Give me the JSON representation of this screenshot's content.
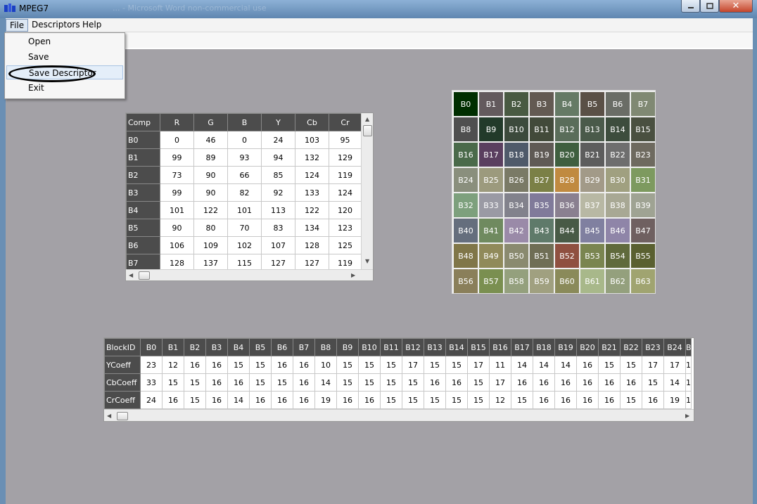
{
  "window": {
    "title": "MPEG7",
    "ghost_title": "... - Microsoft Word non-commercial use"
  },
  "menu": {
    "items": [
      "File",
      "Descriptors",
      "Help"
    ]
  },
  "file_menu": {
    "items": [
      "Open",
      "Save",
      "Save Descriptor",
      "Exit"
    ],
    "highlighted": "Save Descriptor"
  },
  "comp_table": {
    "headers": [
      "Comp",
      "R",
      "G",
      "B",
      "Y",
      "Cb",
      "Cr"
    ],
    "rows": [
      [
        "B0",
        "0",
        "46",
        "0",
        "24",
        "103",
        "95"
      ],
      [
        "B1",
        "99",
        "89",
        "93",
        "94",
        "132",
        "129"
      ],
      [
        "B2",
        "73",
        "90",
        "66",
        "85",
        "124",
        "119"
      ],
      [
        "B3",
        "99",
        "90",
        "82",
        "92",
        "133",
        "124"
      ],
      [
        "B4",
        "101",
        "122",
        "101",
        "113",
        "122",
        "120"
      ],
      [
        "B5",
        "90",
        "80",
        "70",
        "83",
        "134",
        "123"
      ],
      [
        "B6",
        "106",
        "109",
        "102",
        "107",
        "128",
        "125"
      ],
      [
        "B7",
        "128",
        "137",
        "115",
        "127",
        "127",
        "119"
      ]
    ]
  },
  "blocks": {
    "labels": [
      "B0",
      "B1",
      "B2",
      "B3",
      "B4",
      "B5",
      "B6",
      "B7",
      "B8",
      "B9",
      "B10",
      "B11",
      "B12",
      "B13",
      "B14",
      "B15",
      "B16",
      "B17",
      "B18",
      "B19",
      "B20",
      "B21",
      "B22",
      "B23",
      "B24",
      "B25",
      "B26",
      "B27",
      "B28",
      "B29",
      "B30",
      "B31",
      "B32",
      "B33",
      "B34",
      "B35",
      "B36",
      "B37",
      "B38",
      "B39",
      "B40",
      "B41",
      "B42",
      "B43",
      "B44",
      "B45",
      "B46",
      "B47",
      "B48",
      "B49",
      "B50",
      "B51",
      "B52",
      "B53",
      "B54",
      "B55",
      "B56",
      "B57",
      "B58",
      "B59",
      "B60",
      "B61",
      "B62",
      "B63"
    ],
    "colors": [
      "#002e00",
      "#635a5d",
      "#495a42",
      "#635a52",
      "#657a65",
      "#5a5046",
      "#6a6d66",
      "#808973",
      "#4f4f4f",
      "#223a2a",
      "#3c4a3c",
      "#424a3a",
      "#5a6d5a",
      "#4a5a4a",
      "#3d4d3d",
      "#4a5040",
      "#4a6a4a",
      "#5a3f5f",
      "#4f5a6a",
      "#5f5a55",
      "#3f5f3f",
      "#5d5d5d",
      "#6e6e6e",
      "#6e6a5f",
      "#8a8f7d",
      "#9c9a7d",
      "#7a7a66",
      "#7b8046",
      "#c08a40",
      "#a29a88",
      "#a0a080",
      "#7d9a5f",
      "#7da07d",
      "#9a9aa4",
      "#82828c",
      "#807a9a",
      "#8a8090",
      "#b8b8a4",
      "#a8a894",
      "#9fa393",
      "#656e7d",
      "#6f8a5f",
      "#9a8aa8",
      "#5f7a6a",
      "#485a46",
      "#8080a0",
      "#8f85a8",
      "#6f6060",
      "#807648",
      "#908a5a",
      "#8a8a6f",
      "#6f6e55",
      "#8f5040",
      "#7a8550",
      "#606a3c",
      "#5a6030",
      "#8a7f5a",
      "#7a8f50",
      "#94a07d",
      "#a0a080",
      "#8a8a5a",
      "#a8b88a",
      "#94a07d",
      "#a0a470"
    ]
  },
  "coeff_table": {
    "headers": [
      "BlockID",
      "B0",
      "B1",
      "B2",
      "B3",
      "B4",
      "B5",
      "B6",
      "B7",
      "B8",
      "B9",
      "B10",
      "B11",
      "B12",
      "B13",
      "B14",
      "B15",
      "B16",
      "B17",
      "B18",
      "B19",
      "B20",
      "B21",
      "B22",
      "B23",
      "B24",
      "B"
    ],
    "rows": [
      [
        "YCoeff",
        "23",
        "12",
        "16",
        "16",
        "15",
        "15",
        "16",
        "16",
        "10",
        "15",
        "15",
        "15",
        "17",
        "15",
        "15",
        "17",
        "11",
        "14",
        "14",
        "14",
        "16",
        "15",
        "15",
        "17",
        "17",
        "1"
      ],
      [
        "CbCoeff",
        "33",
        "15",
        "15",
        "16",
        "16",
        "15",
        "15",
        "16",
        "14",
        "15",
        "15",
        "15",
        "15",
        "16",
        "16",
        "15",
        "17",
        "16",
        "16",
        "16",
        "16",
        "16",
        "16",
        "15",
        "14",
        "1"
      ],
      [
        "CrCoeff",
        "24",
        "16",
        "15",
        "16",
        "14",
        "16",
        "16",
        "16",
        "19",
        "16",
        "16",
        "15",
        "15",
        "15",
        "15",
        "15",
        "12",
        "15",
        "16",
        "16",
        "16",
        "16",
        "15",
        "16",
        "19",
        "1"
      ]
    ]
  }
}
